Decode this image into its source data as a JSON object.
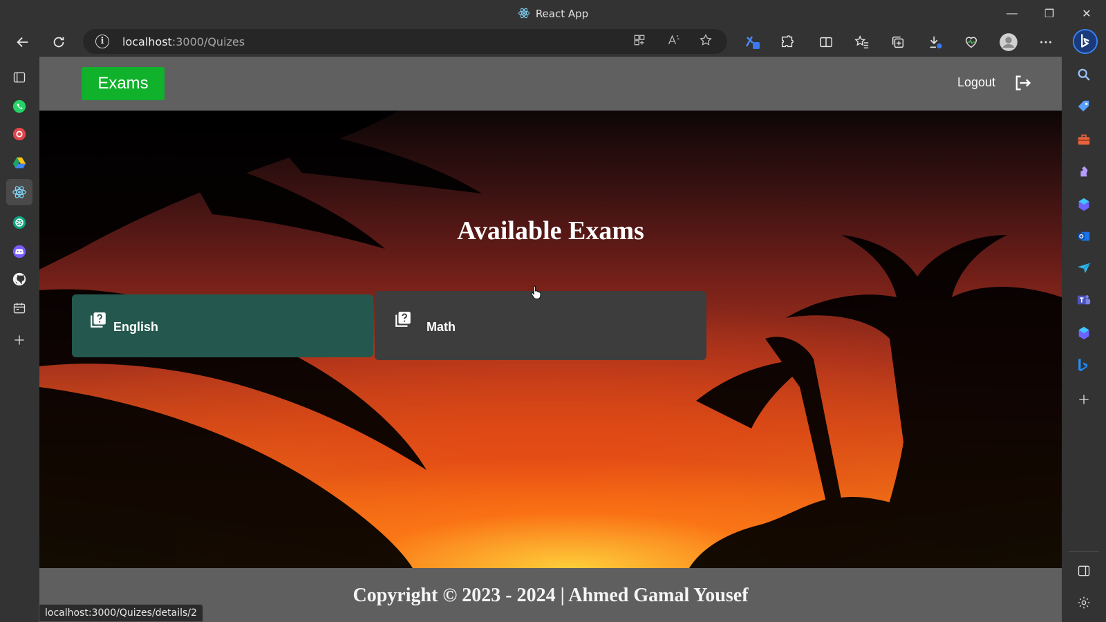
{
  "window": {
    "title": "React App",
    "controls": {
      "minimize": "—",
      "restore": "❐",
      "close": "✕"
    }
  },
  "browser": {
    "url_host": "localhost",
    "url_path": ":3000/Quizes",
    "status_url": "localhost:3000/Quizes/details/2",
    "left_sidebar": [
      "tabs-icon",
      "whatsapp-icon",
      "record-icon",
      "drive-icon",
      "react-icon",
      "chatgpt-icon",
      "discord-icon",
      "github-icon",
      "calendar-icon",
      "add-icon"
    ],
    "right_sidebar": [
      "search-icon",
      "tag-icon",
      "toolbox-icon",
      "chess-icon",
      "copilot-icon",
      "outlook-icon",
      "send-icon",
      "teams-icon",
      "copilot-icon",
      "bing-icon",
      "add-icon"
    ]
  },
  "page": {
    "brand": "Exams",
    "logout": "Logout",
    "hero_title": "Available Exams",
    "exams": [
      {
        "label": "English",
        "color": "#24584f"
      },
      {
        "label": "Math",
        "color": "#3d3d3d"
      }
    ],
    "footer": "Copyright © 2023 - 2024 | Ahmed Gamal Yousef"
  },
  "colors": {
    "brand": "#10b22b",
    "navbar": "#606060",
    "chrome": "#333333"
  }
}
